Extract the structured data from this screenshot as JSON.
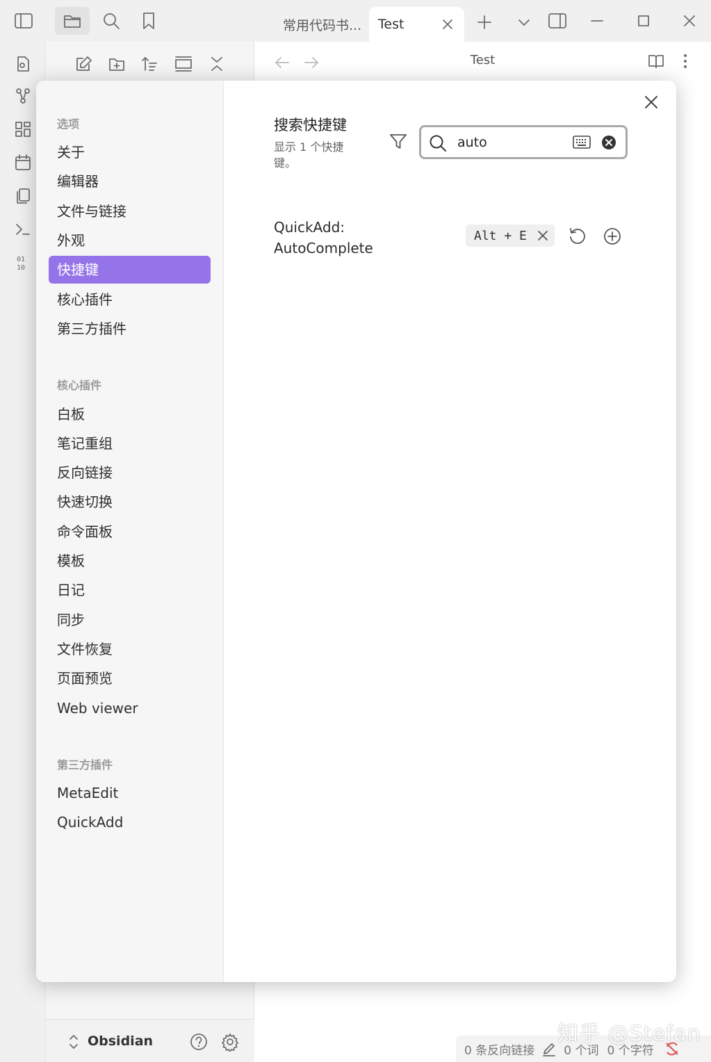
{
  "tabs": {
    "inactive_label": "常用代码书...",
    "active_label": "Test"
  },
  "view": {
    "title": "Test"
  },
  "vault": {
    "name": "Obsidian"
  },
  "status": {
    "backlinks": "0 条反向链接",
    "words": "0 个词",
    "chars": "0 个字符"
  },
  "watermark": "知乎 @Stefan",
  "settings": {
    "nav": {
      "options_title": "选项",
      "options": [
        "关于",
        "编辑器",
        "文件与链接",
        "外观",
        "快捷键",
        "核心插件",
        "第三方插件"
      ],
      "active": "快捷键",
      "core_title": "核心插件",
      "core": [
        "白板",
        "笔记重组",
        "反向链接",
        "快速切换",
        "命令面板",
        "模板",
        "日记",
        "同步",
        "文件恢复",
        "页面预览",
        "Web viewer"
      ],
      "third_title": "第三方插件",
      "third": [
        "MetaEdit",
        "QuickAdd"
      ]
    },
    "hotkeys": {
      "search_title": "搜索快捷键",
      "search_desc": "显示 1 个快捷键。",
      "search_value": "auto",
      "results": [
        {
          "name_line1": "QuickAdd:",
          "name_line2": "AutoComplete",
          "binding": "Alt + E"
        }
      ]
    }
  },
  "colors": {
    "accent": "#9474e8",
    "modal_bg": "#ffffff",
    "nav_bg": "#f6f6f6"
  },
  "icons": [
    "sidebar-toggle-icon",
    "folder-icon",
    "search-icon",
    "bookmark-icon",
    "new-note-icon",
    "new-folder-icon",
    "sort-icon",
    "collapse-icon",
    "close-icon",
    "filter-icon",
    "keyboard-icon",
    "clear-icon",
    "restore-icon",
    "add-circle-icon",
    "help-icon",
    "gear-icon"
  ]
}
